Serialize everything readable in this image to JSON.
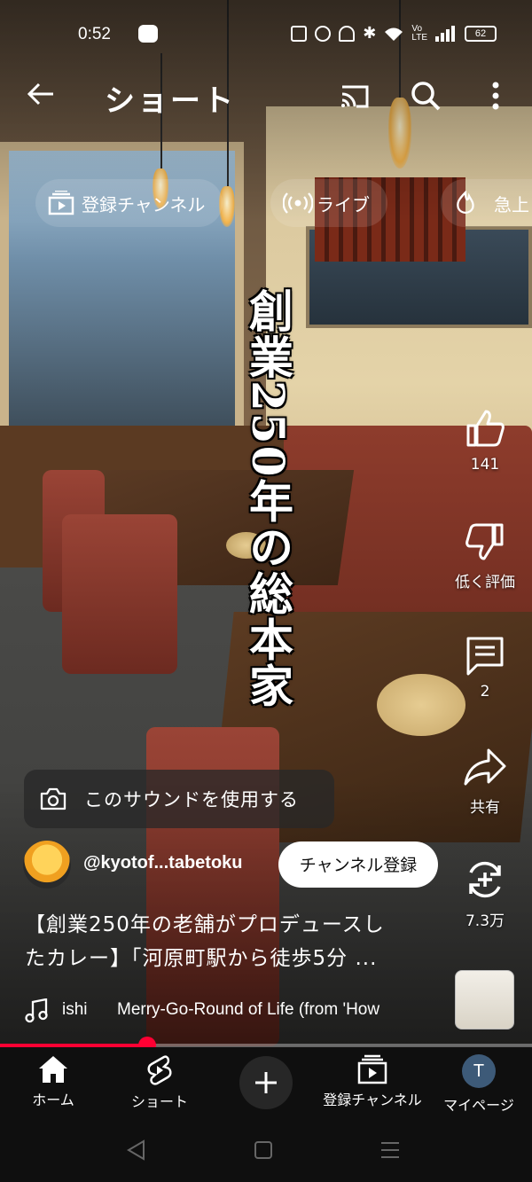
{
  "status_bar": {
    "time": "0:52",
    "battery": "62",
    "icons": [
      "line-icon",
      "nfc-icon",
      "alarm-icon",
      "mute-icon",
      "bluetooth-icon",
      "wifi-icon",
      "volte-icon",
      "signal-icon",
      "battery-icon"
    ]
  },
  "app_bar": {
    "title": "ショート"
  },
  "chips": [
    {
      "label": "登録チャンネル",
      "icon": "subscriptions-icon"
    },
    {
      "label": "ライブ",
      "icon": "live-icon"
    },
    {
      "label": "急上",
      "icon": "trending-icon"
    }
  ],
  "video": {
    "overlay_caption": "創業250年の総本家"
  },
  "actions": {
    "like_count": "141",
    "dislike_label": "低く評価",
    "comment_count": "2",
    "share_label": "共有",
    "remix_count": "7.3万"
  },
  "sound_button": {
    "label": "このサウンドを使用する"
  },
  "channel": {
    "handle": "@kyotof...tabetoku",
    "subscribe_label": "チャンネル登録"
  },
  "title": {
    "line1": "【創業250年の老舗がプロデュースし",
    "line2": "たカレー】「河原町駅から徒歩5分 ..."
  },
  "music": {
    "artist": "ishi",
    "track": "Merry-Go-Round of Life (from 'How"
  },
  "progress": {
    "fraction": 0.277
  },
  "bottom_nav": {
    "home": "ホーム",
    "shorts": "ショート",
    "subscriptions": "登録チャンネル",
    "me": "マイページ",
    "avatar_letter": "T"
  },
  "colors": {
    "accent": "#ff0033",
    "background": "#0f0f0f"
  }
}
